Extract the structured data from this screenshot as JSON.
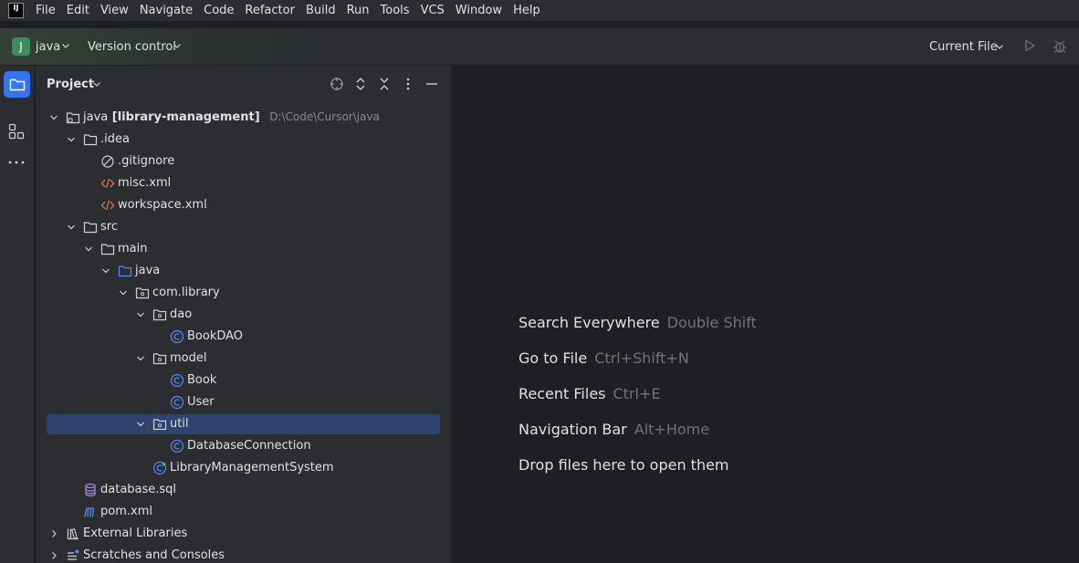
{
  "menubar": {
    "logo": "IJ",
    "items": [
      "File",
      "Edit",
      "View",
      "Navigate",
      "Code",
      "Refactor",
      "Build",
      "Run",
      "Tools",
      "VCS",
      "Window",
      "Help"
    ]
  },
  "toolbar": {
    "project_badge": "J",
    "project_name": "java",
    "version_control": "Version control",
    "run_config": "Current File"
  },
  "panel": {
    "title": "Project"
  },
  "tree": {
    "root_name": "java",
    "root_module": "[library-management]",
    "root_path": "D:\\Code\\Cursor\\java",
    "idea": ".idea",
    "gitignore": ".gitignore",
    "misc": "misc.xml",
    "workspace": "workspace.xml",
    "src": "src",
    "main": "main",
    "java": "java",
    "pkg": "com.library",
    "dao": "dao",
    "bookdao": "BookDAO",
    "model": "model",
    "book": "Book",
    "user": "User",
    "util": "util",
    "dbconn": "DatabaseConnection",
    "lms": "LibraryManagementSystem",
    "sql": "database.sql",
    "pom": "pom.xml",
    "extlib": "External Libraries",
    "scratches": "Scratches and Consoles"
  },
  "editor": {
    "tips": [
      {
        "action": "Search Everywhere",
        "shortcut": "Double Shift"
      },
      {
        "action": "Go to File",
        "shortcut": "Ctrl+Shift+N"
      },
      {
        "action": "Recent Files",
        "shortcut": "Ctrl+E"
      },
      {
        "action": "Navigation Bar",
        "shortcut": "Alt+Home"
      },
      {
        "action": "Drop files here to open them",
        "shortcut": ""
      }
    ]
  },
  "colors": {
    "accent": "#3574f0",
    "selection": "#2e436e",
    "panel_bg": "#2b2d30",
    "editor_bg": "#1e1f22",
    "class_icon": "#548af7",
    "xml_icon": "#e0794c",
    "sql_icon": "#a889e0"
  },
  "icons": {
    "logo": "intellij-logo-icon",
    "project_tool": "folder-icon",
    "structure_tool": "structure-icon",
    "more_tools": "more-horizontal-icon",
    "locate": "crosshair-icon",
    "expand": "expand-all-icon",
    "collapse": "collapse-all-icon",
    "options": "more-vertical-icon",
    "hide": "minimize-icon",
    "run": "play-icon",
    "debug": "bug-icon"
  }
}
